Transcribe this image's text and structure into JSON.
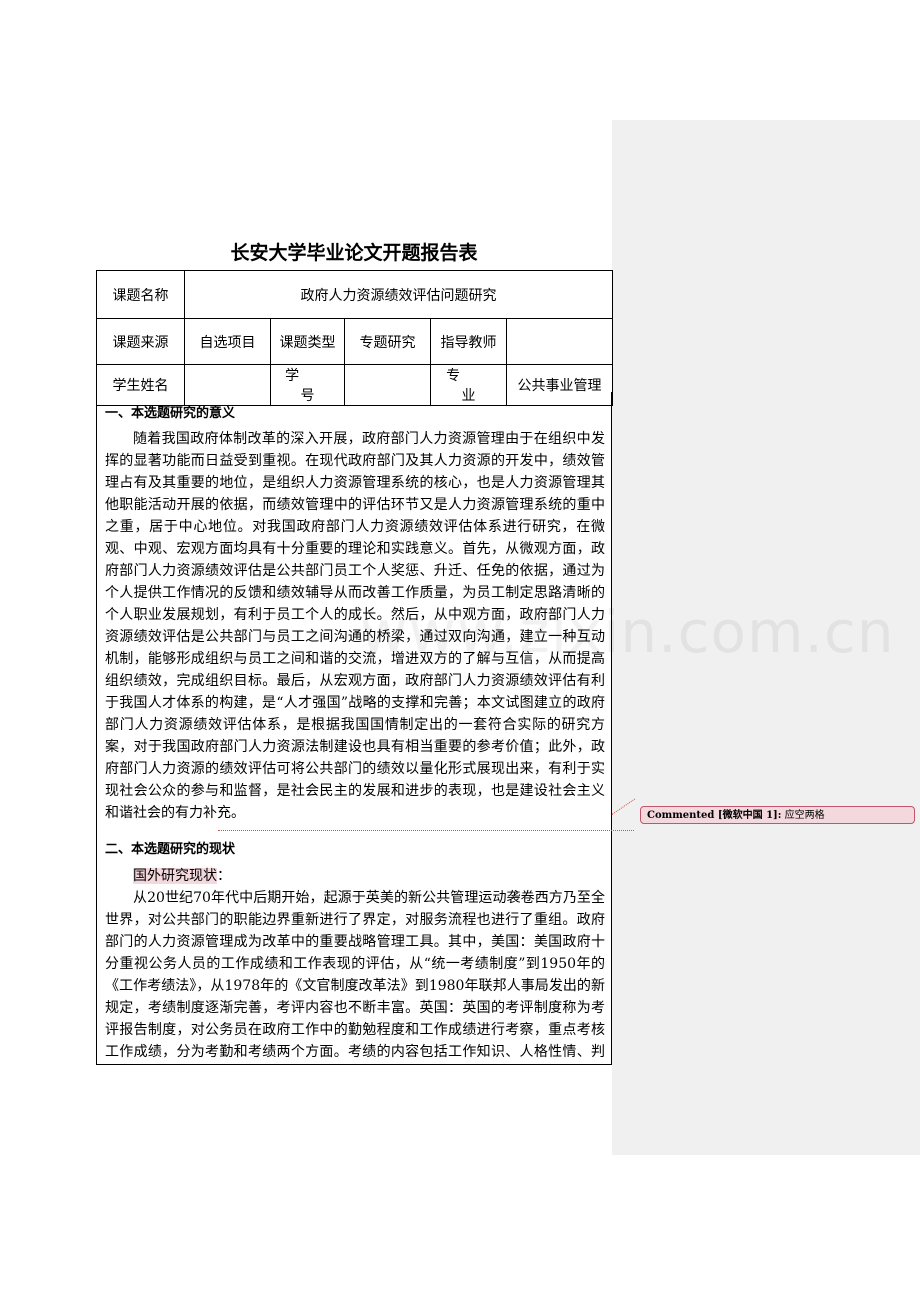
{
  "watermark": "www.zixin.com.cn",
  "title": "长安大学毕业论文开题报告表",
  "info_table": {
    "topic_label": "课题名称",
    "topic_value": "政府人力资源绩效评估问题研究",
    "source_label": "课题来源",
    "source_value": "自选项目",
    "type_label": "课题类型",
    "type_value": "专题研究",
    "advisor_label": "指导教师",
    "advisor_value": "",
    "student_label": "学生姓名",
    "student_value": "",
    "id_label": "学号",
    "id_value": "",
    "major_label": "专业",
    "major_value": "公共事业管理"
  },
  "section1": {
    "heading": "一、本选题研究的意义",
    "body": "随着我国政府体制改革的深入开展，政府部门人力资源管理由于在组织中发挥的显著功能而日益受到重视。在现代政府部门及其人力资源的开发中，绩效管理占有及其重要的地位，是组织人力资源管理系统的核心，也是人力资源管理其他职能活动开展的依据，而绩效管理中的评估环节又是人力资源管理系统的重中之重，居于中心地位。对我国政府部门人力资源绩效评估体系进行研究，在微观、中观、宏观方面均具有十分重要的理论和实践意义。首先，从微观方面，政府部门人力资源绩效评估是公共部门员工个人奖惩、升迁、任免的依据，通过为个人提供工作情况的反馈和绩效辅导从而改善工作质量，为员工制定思路清晰的个人职业发展规划，有利于员工个人的成长。然后，从中观方面，政府部门人力资源绩效评估是公共部门与员工之间沟通的桥梁，通过双向沟通，建立一种互动机制，能够形成组织与员工之间和谐的交流，增进双方的了解与互信，从而提高组织绩效，完成组织目标。最后，从宏观方面，政府部门人力资源绩效评估有利于我国人才体系的构建，是“人才强国”战略的支撑和完善；本文试图建立的政府部门人力资源绩效评估体系，是根据我国国情制定出的一套符合实际的研究方案，对于我国政府部门人力资源法制建设也具有相当重要的参考价值；此外，政府部门人力资源的绩效评估可将公共部门的绩效以量化形式展现出来，有利于实现社会公众的参与和监督，是社会民主的发展和进步的表现，也是建设社会主义和谐社会的有力补充。"
  },
  "section2": {
    "heading": "二、本选题研究的现状",
    "subheading": "国外研究现状",
    "subheading_punct": "：",
    "body": "从20世纪70年代中后期开始，起源于英美的新公共管理运动袭卷西方乃至全世界，对公共部门的职能边界重新进行了界定，对服务流程也进行了重组。政府部门的人力资源管理成为改革中的重要战略管理工具。其中，美国：美国政府十分重视公务人员的工作成绩和工作表现的评估，从“统一考绩制度”到1950年的《工作考绩法》，从1978年的《文官制度改革法》到1980年联邦人事局发出的新规定，考绩制度逐渐完善，考评内容也不断丰富。英国：英国的考评制度称为考评报告制度，对公务员在政府工作中的勤勉程度和工作成绩进行考察，重点考核工作成绩，分为考勤和考绩两个方面。考绩的内容包括工作知识、人格性情、判断力、责任心、创造力、可靠性、机敏适应性、监督能力、热心状况、行为道德等。日本：日本政府实行工作评定制度，评定的内容主要分为工作成绩、工作能力、性格、工作适应性四个方面。总之，国外对政府部门人力资源的绩效"
  },
  "comment": {
    "author": "Commented [微软中国 1]:",
    "text": "应空两格"
  },
  "colors": {
    "margin_pane": "#f0f0f0",
    "highlight": "#f3d8de",
    "comment_border": "#c0566a"
  }
}
